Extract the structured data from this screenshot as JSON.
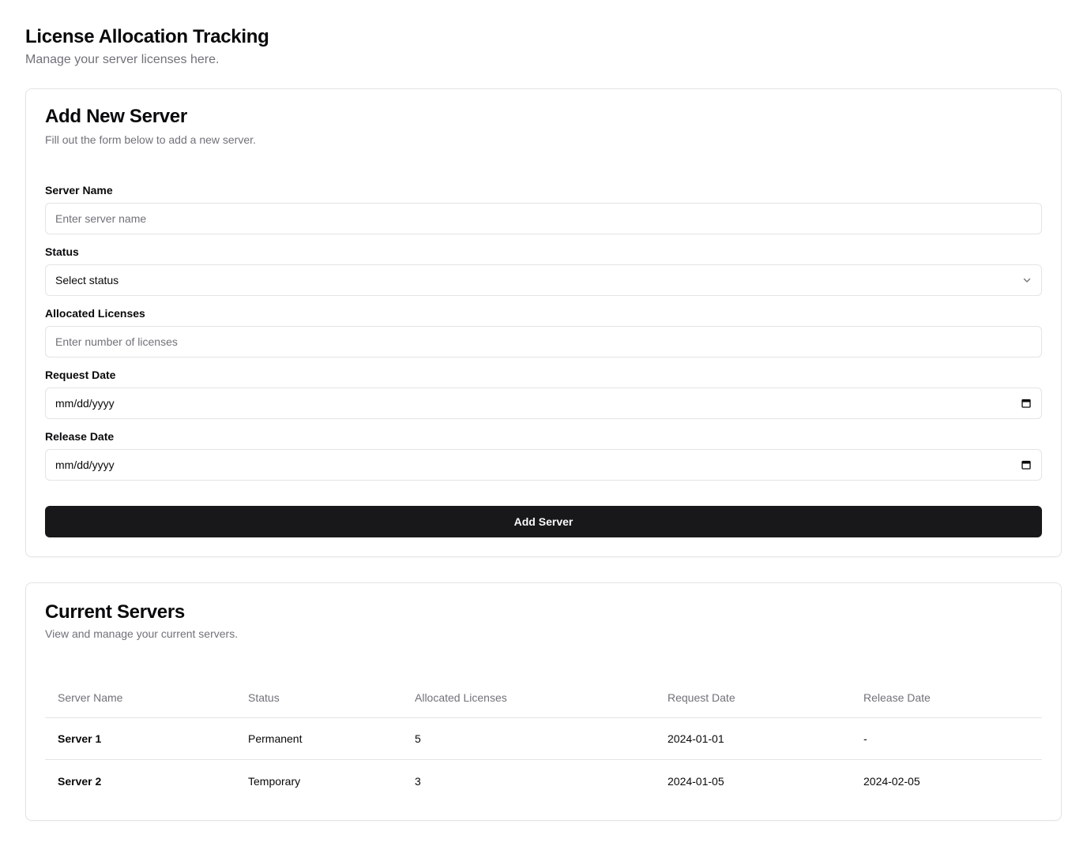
{
  "page": {
    "title": "License Allocation Tracking",
    "subtitle": "Manage your server licenses here."
  },
  "form": {
    "title": "Add New Server",
    "description": "Fill out the form below to add a new server.",
    "fields": {
      "server_name": {
        "label": "Server Name",
        "placeholder": "Enter server name",
        "value": ""
      },
      "status": {
        "label": "Status",
        "value": "Select status"
      },
      "allocated_licenses": {
        "label": "Allocated Licenses",
        "placeholder": "Enter number of licenses",
        "value": ""
      },
      "request_date": {
        "label": "Request Date",
        "value": "mm/dd/yyyy"
      },
      "release_date": {
        "label": "Release Date",
        "value": "mm/dd/yyyy"
      }
    },
    "submit_label": "Add Server"
  },
  "servers": {
    "title": "Current Servers",
    "description": "View and manage your current servers.",
    "columns": [
      "Server Name",
      "Status",
      "Allocated Licenses",
      "Request Date",
      "Release Date"
    ],
    "rows": [
      [
        "Server 1",
        "Permanent",
        "5",
        "2024-01-01",
        "-"
      ],
      [
        "Server 2",
        "Temporary",
        "3",
        "2024-01-05",
        "2024-02-05"
      ]
    ]
  },
  "icons": {
    "select": "chevron-down-icon",
    "date": "calendar-icon"
  },
  "colors": {
    "primary_button": "#18181b",
    "muted_text": "#71717a",
    "border": "#e4e4e7"
  }
}
